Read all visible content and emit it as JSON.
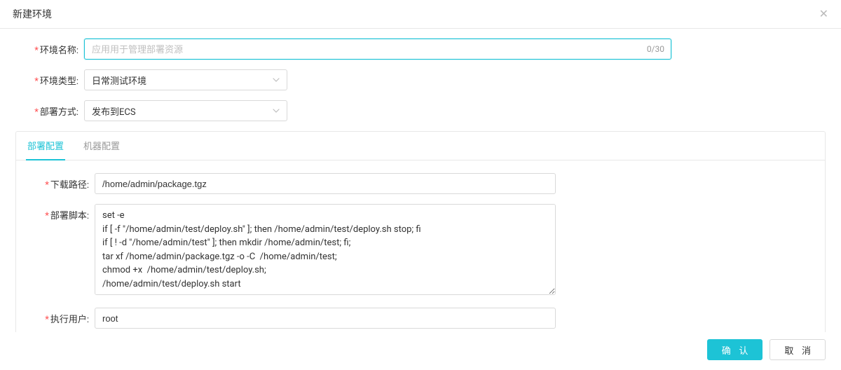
{
  "dialog": {
    "title": "新建环境"
  },
  "form": {
    "env_name": {
      "label": "环境名称:",
      "placeholder": "应用用于管理部署资源",
      "value": "",
      "counter": "0/30"
    },
    "env_type": {
      "label": "环境类型:",
      "value": "日常测试环境"
    },
    "deploy_method": {
      "label": "部署方式:",
      "value": "发布到ECS"
    }
  },
  "tabs": [
    {
      "key": "deploy",
      "label": "部署配置",
      "active": true
    },
    {
      "key": "machine",
      "label": "机器配置",
      "active": false
    }
  ],
  "deploy": {
    "download_path": {
      "label": "下载路径:",
      "value": "/home/admin/package.tgz"
    },
    "script": {
      "label": "部署脚本:",
      "value": "set -e\nif [ -f \"/home/admin/test/deploy.sh\" ]; then /home/admin/test/deploy.sh stop; fi\nif [ ! -d \"/home/admin/test\" ]; then mkdir /home/admin/test; fi;\ntar xf /home/admin/package.tgz -o -C  /home/admin/test;\nchmod +x  /home/admin/test/deploy.sh;\n/home/admin/test/deploy.sh start"
    },
    "exec_user": {
      "label": "执行用户:",
      "value": "root"
    }
  },
  "footer": {
    "ok": "确 认",
    "cancel": "取 消"
  }
}
